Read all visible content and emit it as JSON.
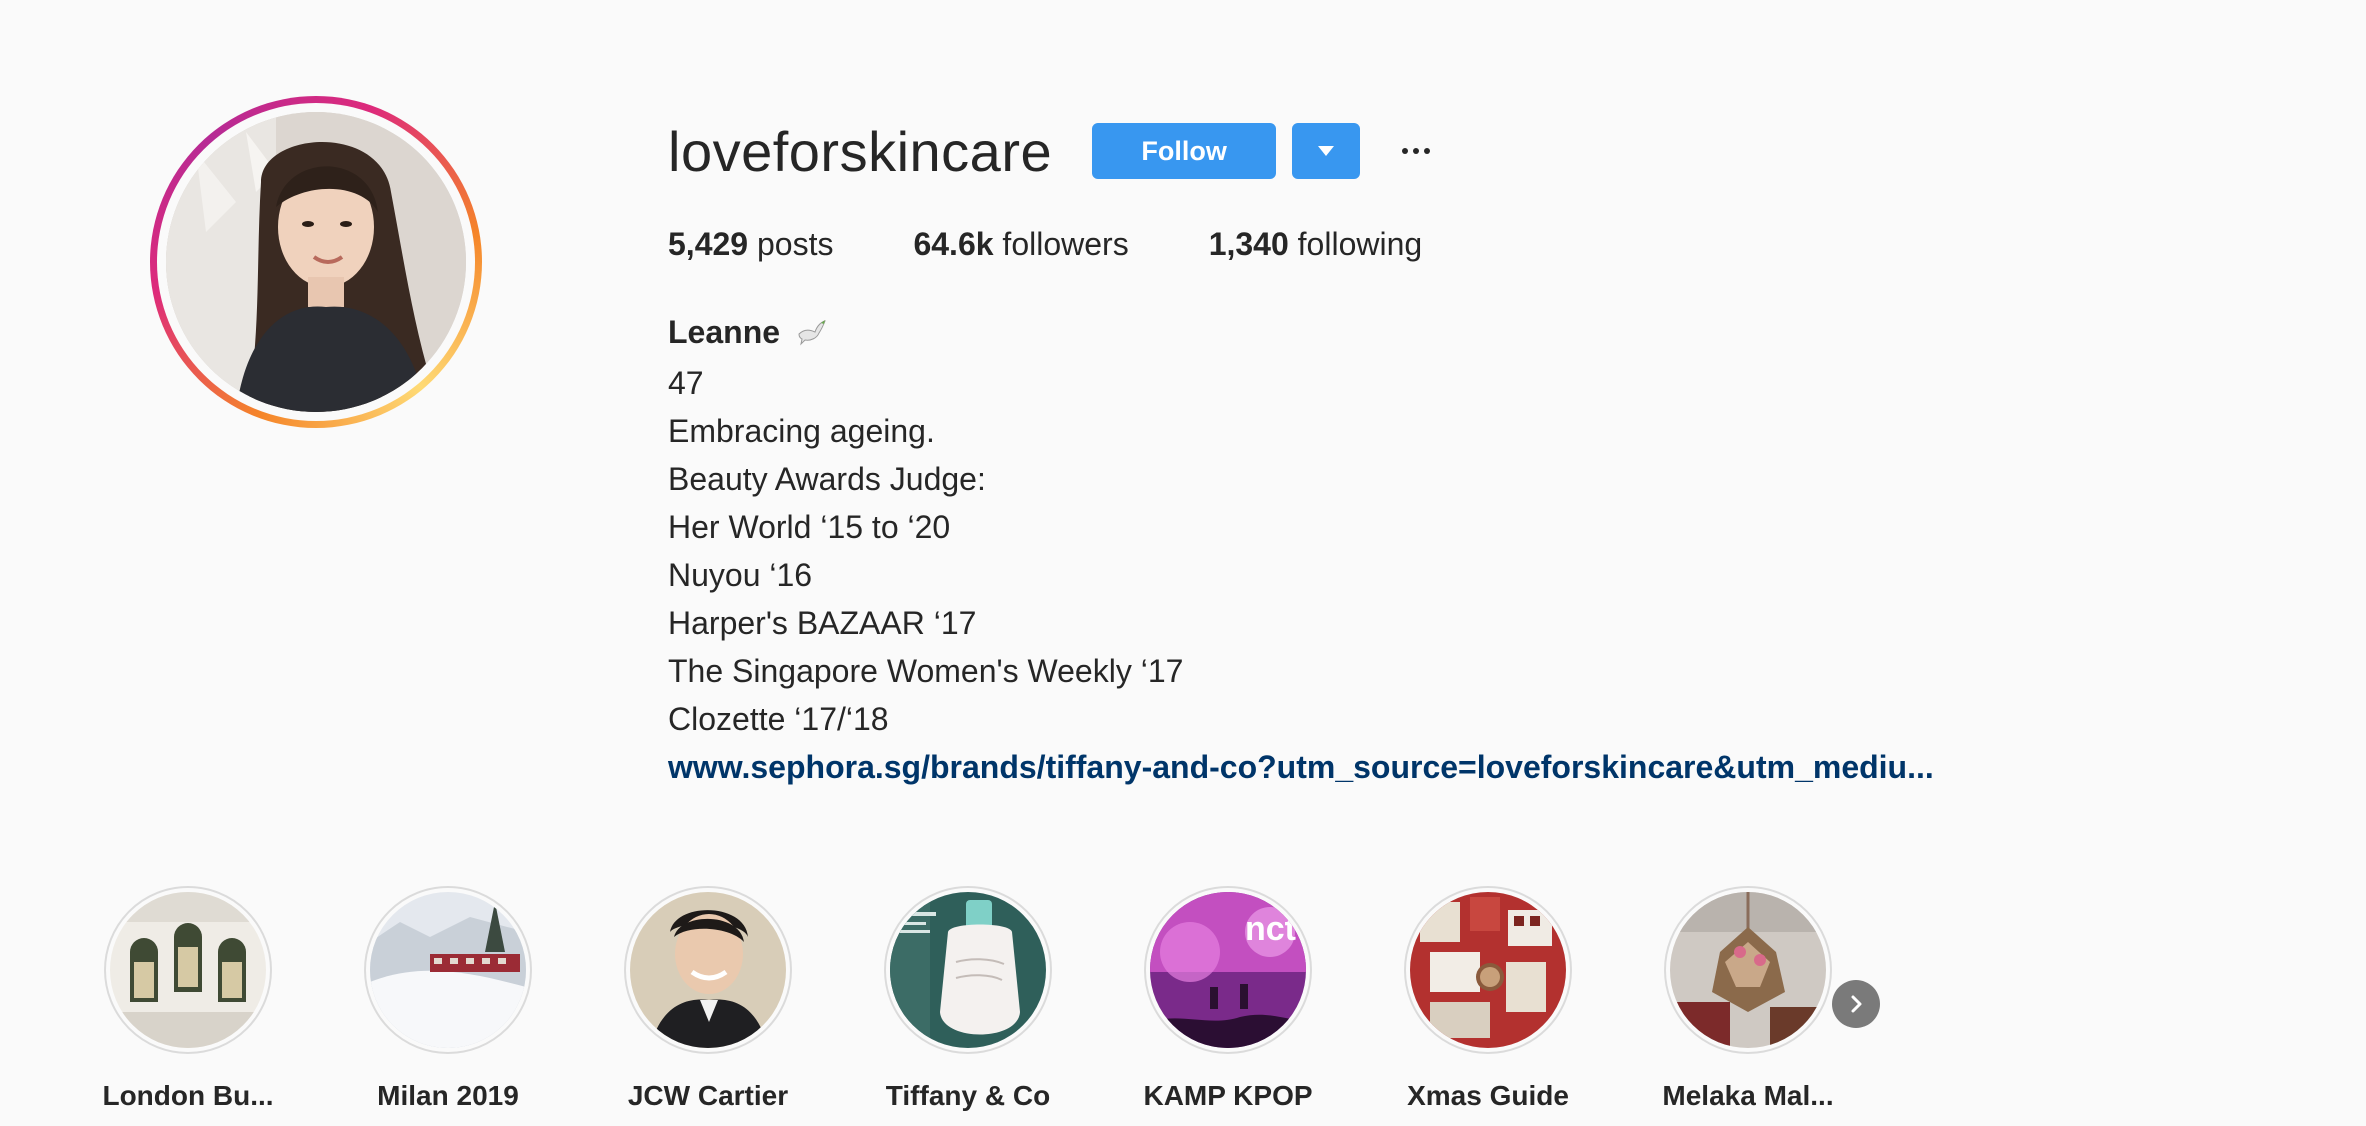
{
  "profile": {
    "username": "loveforskincare",
    "follow_label": "Follow",
    "stats": {
      "posts_count": "5,429",
      "posts_label": " posts",
      "followers_count": "64.6k",
      "followers_label": " followers",
      "following_count": "1,340",
      "following_label": " following"
    },
    "bio": {
      "name": "Leanne",
      "name_emoji": "dove-emoji",
      "lines": [
        "47",
        "Embracing ageing.",
        "Beauty Awards Judge:",
        "Her World ‘15 to ‘20",
        "Nuyou ‘16",
        "Harper's BAZAAR ‘17",
        "The Singapore Women's Weekly ‘17",
        "Clozette ‘17/‘18"
      ],
      "link": "www.sephora.sg/brands/tiffany-and-co?utm_source=loveforskincare&utm_mediu..."
    }
  },
  "highlights": [
    {
      "label": "London Bu..."
    },
    {
      "label": "Milan 2019"
    },
    {
      "label": "JCW Cartier"
    },
    {
      "label": "Tiffany & Co"
    },
    {
      "label": "KAMP KPOP"
    },
    {
      "label": "Xmas Guide"
    },
    {
      "label": "Melaka Mal..."
    }
  ],
  "icons": {
    "dropdown": "triangle-down-icon",
    "more": "more-options-icon",
    "next": "chevron-right-icon"
  },
  "colors": {
    "follow_button": "#3897f0",
    "link": "#003569",
    "background": "#fafafa"
  }
}
